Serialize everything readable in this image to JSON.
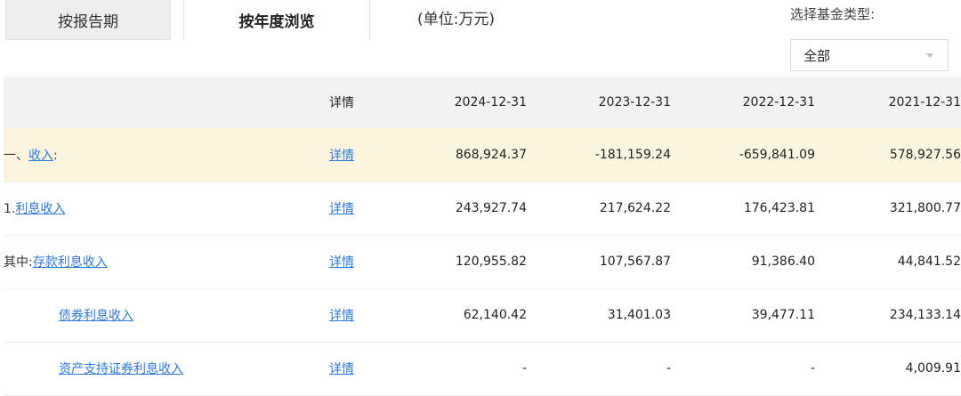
{
  "tabs": {
    "by_period": "按报告期",
    "by_year": "按年度浏览"
  },
  "unit_label": "(单位:万元)",
  "fund_type": {
    "label": "选择基金类型:",
    "selected": "全部"
  },
  "table": {
    "headers": [
      "",
      "详情",
      "2024-12-31",
      "2023-12-31",
      "2022-12-31",
      "2021-12-31"
    ],
    "rows": [
      {
        "prefix": "一、",
        "link": "收入",
        "suffix": ":",
        "detail": "详情",
        "values": [
          "868,924.37",
          "-181,159.24",
          "-659,841.09",
          "578,927.56"
        ]
      },
      {
        "prefix": "1.",
        "link": "利息收入",
        "suffix": "",
        "detail": "详情",
        "values": [
          "243,927.74",
          "217,624.22",
          "176,423.81",
          "321,800.77"
        ]
      },
      {
        "prefix": "其中:",
        "link": "存款利息收入",
        "suffix": "",
        "detail": "详情",
        "values": [
          "120,955.82",
          "107,567.87",
          "91,386.40",
          "44,841.52"
        ]
      },
      {
        "prefix": "",
        "link": "债券利息收入",
        "suffix": "",
        "detail": "详情",
        "values": [
          "62,140.42",
          "31,401.03",
          "39,477.11",
          "234,133.14"
        ]
      },
      {
        "prefix": "",
        "link": "资产支持证券利息收入",
        "suffix": "",
        "detail": "详情",
        "values": [
          "-",
          "-",
          "-",
          "4,009.91"
        ]
      }
    ]
  }
}
